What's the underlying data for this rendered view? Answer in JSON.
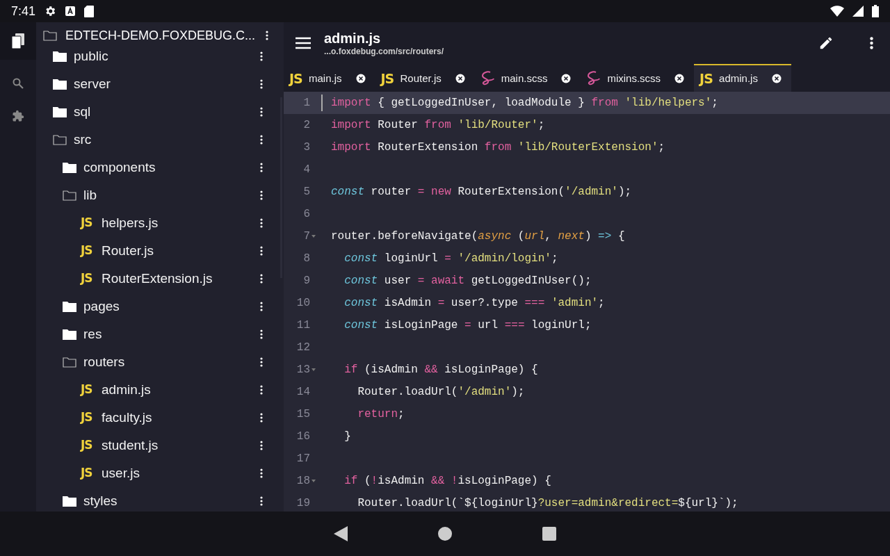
{
  "status_bar": {
    "time": "7:41"
  },
  "sidebar": {
    "title": "EDTECH-DEMO.FOXDEBUG.C...",
    "tree": [
      {
        "name": "public",
        "kind": "folder",
        "expanded": false
      },
      {
        "name": "server",
        "kind": "folder",
        "expanded": false
      },
      {
        "name": "sql",
        "kind": "folder",
        "expanded": false
      },
      {
        "name": "src",
        "kind": "folder",
        "expanded": true,
        "children": [
          {
            "name": "components",
            "kind": "folder",
            "expanded": false
          },
          {
            "name": "lib",
            "kind": "folder",
            "expanded": true,
            "children": [
              {
                "name": "helpers.js",
                "kind": "js",
                "icon": "JS"
              },
              {
                "name": "Router.js",
                "kind": "js",
                "icon": "JS"
              },
              {
                "name": "RouterExtension.js",
                "kind": "js",
                "icon": "JS"
              }
            ]
          },
          {
            "name": "pages",
            "kind": "folder",
            "expanded": false
          },
          {
            "name": "res",
            "kind": "folder",
            "expanded": false
          },
          {
            "name": "routers",
            "kind": "folder",
            "expanded": true,
            "children": [
              {
                "name": "admin.js",
                "kind": "js",
                "icon": "JS"
              },
              {
                "name": "faculty.js",
                "kind": "js",
                "icon": "JS"
              },
              {
                "name": "student.js",
                "kind": "js",
                "icon": "JS"
              },
              {
                "name": "user.js",
                "kind": "js",
                "icon": "JS"
              }
            ]
          },
          {
            "name": "styles",
            "kind": "folder",
            "expanded": false
          }
        ]
      }
    ]
  },
  "header": {
    "title": "admin.js",
    "path": "...o.foxdebug.com/src/routers/"
  },
  "tabs": [
    {
      "label": "main.js",
      "kind": "js",
      "icon": "JS",
      "selected": false
    },
    {
      "label": "Router.js",
      "kind": "js",
      "icon": "JS",
      "selected": false
    },
    {
      "label": "main.scss",
      "kind": "sass",
      "selected": false
    },
    {
      "label": "mixins.scss",
      "kind": "sass",
      "selected": false
    },
    {
      "label": "admin.js",
      "kind": "js",
      "icon": "JS",
      "selected": true
    }
  ],
  "code": [
    {
      "number": "1",
      "active": true,
      "foldable": false,
      "tokens": [
        {
          "text": "import",
          "kind": "keyword"
        },
        {
          "text": " { getLoggedInUser, loadModule } ",
          "kind": "plain"
        },
        {
          "text": "from",
          "kind": "keyword"
        },
        {
          "text": " 'lib/helpers'",
          "kind": "string"
        },
        {
          "text": ";",
          "kind": "plain"
        }
      ]
    },
    {
      "number": "2",
      "active": false,
      "foldable": false,
      "tokens": [
        {
          "text": "import",
          "kind": "keyword"
        },
        {
          "text": " Router ",
          "kind": "plain"
        },
        {
          "text": "from",
          "kind": "keyword"
        },
        {
          "text": " 'lib/Router'",
          "kind": "string"
        },
        {
          "text": ";",
          "kind": "plain"
        }
      ]
    },
    {
      "number": "3",
      "active": false,
      "foldable": false,
      "tokens": [
        {
          "text": "import",
          "kind": "keyword"
        },
        {
          "text": " RouterExtension ",
          "kind": "plain"
        },
        {
          "text": "from",
          "kind": "keyword"
        },
        {
          "text": " 'lib/RouterExtension'",
          "kind": "string"
        },
        {
          "text": ";",
          "kind": "plain"
        }
      ]
    },
    {
      "number": "4",
      "active": false,
      "foldable": false
    },
    {
      "number": "5",
      "active": false,
      "foldable": false,
      "tokens": [
        {
          "text": "const",
          "kind": "storage"
        },
        {
          "text": " router ",
          "kind": "plain"
        },
        {
          "text": "= new",
          "kind": "keyword"
        },
        {
          "text": " RouterExtension(",
          "kind": "plain"
        },
        {
          "text": "'/admin'",
          "kind": "string"
        },
        {
          "text": ");",
          "kind": "plain"
        }
      ]
    },
    {
      "number": "6",
      "active": false,
      "foldable": false
    },
    {
      "number": "7",
      "active": false,
      "foldable": true,
      "tokens": [
        {
          "text": "router.beforeNavigate(",
          "kind": "plain"
        },
        {
          "text": "async",
          "kind": "param"
        },
        {
          "text": " (",
          "kind": "plain"
        },
        {
          "text": "url",
          "kind": "param"
        },
        {
          "text": ", ",
          "kind": "plain"
        },
        {
          "text": "next",
          "kind": "param"
        },
        {
          "text": ") ",
          "kind": "plain"
        },
        {
          "text": "=>",
          "kind": "storage"
        },
        {
          "text": " {",
          "kind": "plain"
        }
      ]
    },
    {
      "number": "8",
      "active": false,
      "foldable": false,
      "tokens": [
        {
          "text": "  const",
          "kind": "storage"
        },
        {
          "text": " loginUrl ",
          "kind": "plain"
        },
        {
          "text": "=",
          "kind": "keyword"
        },
        {
          "text": " '/admin/login'",
          "kind": "string"
        },
        {
          "text": ";",
          "kind": "plain"
        }
      ]
    },
    {
      "number": "9",
      "active": false,
      "foldable": false,
      "tokens": [
        {
          "text": "  const",
          "kind": "storage"
        },
        {
          "text": " user ",
          "kind": "plain"
        },
        {
          "text": "= await",
          "kind": "keyword"
        },
        {
          "text": " getLoggedInUser();",
          "kind": "plain"
        }
      ]
    },
    {
      "number": "10",
      "active": false,
      "foldable": false,
      "tokens": [
        {
          "text": "  const",
          "kind": "storage"
        },
        {
          "text": " isAdmin ",
          "kind": "plain"
        },
        {
          "text": "=",
          "kind": "keyword"
        },
        {
          "text": " user?.type ",
          "kind": "plain"
        },
        {
          "text": "===",
          "kind": "keyword"
        },
        {
          "text": " 'admin'",
          "kind": "string"
        },
        {
          "text": ";",
          "kind": "plain"
        }
      ]
    },
    {
      "number": "11",
      "active": false,
      "foldable": false,
      "tokens": [
        {
          "text": "  const",
          "kind": "storage"
        },
        {
          "text": " isLoginPage ",
          "kind": "plain"
        },
        {
          "text": "=",
          "kind": "keyword"
        },
        {
          "text": " url ",
          "kind": "plain"
        },
        {
          "text": "===",
          "kind": "keyword"
        },
        {
          "text": " loginUrl;",
          "kind": "plain"
        }
      ]
    },
    {
      "number": "12",
      "active": false,
      "foldable": false
    },
    {
      "number": "13",
      "active": false,
      "foldable": true,
      "tokens": [
        {
          "text": "  if",
          "kind": "keyword"
        },
        {
          "text": " (isAdmin ",
          "kind": "plain"
        },
        {
          "text": "&&",
          "kind": "keyword"
        },
        {
          "text": " isLoginPage) {",
          "kind": "plain"
        }
      ]
    },
    {
      "number": "14",
      "active": false,
      "foldable": false,
      "tokens": [
        {
          "text": "    Router.loadUrl(",
          "kind": "plain"
        },
        {
          "text": "'/admin'",
          "kind": "string"
        },
        {
          "text": ");",
          "kind": "plain"
        }
      ]
    },
    {
      "number": "15",
      "active": false,
      "foldable": false,
      "tokens": [
        {
          "text": "    return",
          "kind": "keyword"
        },
        {
          "text": ";",
          "kind": "plain"
        }
      ]
    },
    {
      "number": "16",
      "active": false,
      "foldable": false,
      "tokens": [
        {
          "text": "  }",
          "kind": "plain"
        }
      ]
    },
    {
      "number": "17",
      "active": false,
      "foldable": false
    },
    {
      "number": "18",
      "active": false,
      "foldable": true,
      "tokens": [
        {
          "text": "  if",
          "kind": "keyword"
        },
        {
          "text": " (",
          "kind": "plain"
        },
        {
          "text": "!",
          "kind": "keyword"
        },
        {
          "text": "isAdmin ",
          "kind": "plain"
        },
        {
          "text": "&& !",
          "kind": "keyword"
        },
        {
          "text": "isLoginPage) {",
          "kind": "plain"
        }
      ]
    },
    {
      "number": "19",
      "active": false,
      "foldable": false,
      "tokens": [
        {
          "text": "    Router.loadUrl(`${loginUrl}",
          "kind": "plain"
        },
        {
          "text": "?user=admin&redirect=",
          "kind": "string"
        },
        {
          "text": "${url}`);",
          "kind": "plain"
        }
      ]
    }
  ]
}
